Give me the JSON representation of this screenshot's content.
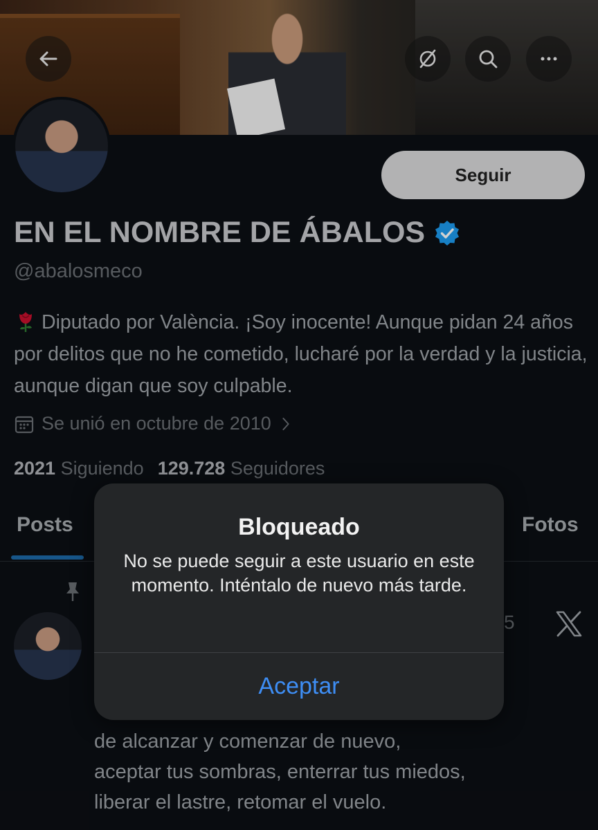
{
  "header": {
    "back_icon": "arrow-left-icon",
    "action_icons": [
      "no-retweet-icon",
      "search-icon",
      "more-icon"
    ]
  },
  "profile": {
    "follow_label": "Seguir",
    "display_name": "EN EL NOMBRE DE ÁBALOS",
    "verified": true,
    "handle": "@abalosmeco",
    "bio": "Diputado por València. ¡Soy inocente! Aunque pidan 24 años por delitos que no he cometido, lucharé por la verdad y la justicia, aunque digan que soy culpable.",
    "joined": "Se unió en octubre de 2010",
    "following_count": "2021",
    "following_label": "Siguiendo",
    "followers_count": "129.728",
    "followers_label": "Seguidores"
  },
  "tabs": {
    "posts": "Posts",
    "photos": "Fotos"
  },
  "post": {
    "time_fragment": "5",
    "text_lines": [
      "de alcanzar y comenzar de nuevo,",
      "aceptar tus sombras, enterrar tus miedos,",
      "liberar el lastre, retomar el vuelo."
    ]
  },
  "alert": {
    "title": "Bloqueado",
    "message": "No se puede seguir a este usuario en este momento. Inténtalo de nuevo más tarde.",
    "button": "Aceptar"
  },
  "colors": {
    "background": "#0c0f14",
    "accent_blue": "#3e8ef5",
    "verified_blue": "#1d9bf0",
    "tab_underline": "#1d6aa8"
  }
}
